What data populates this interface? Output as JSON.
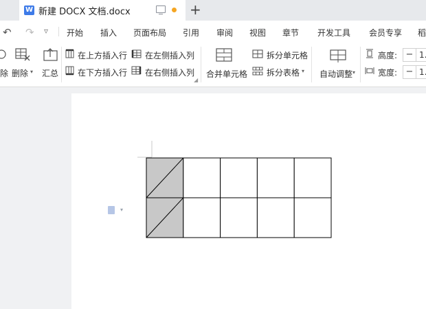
{
  "tab": {
    "doc_icon": "W",
    "title": "新建 DOCX 文档.docx",
    "monitor_icon": "monitor-icon",
    "unsaved_dot_color": "#f5a623",
    "new_tab": "+"
  },
  "quick": {
    "undo": "↶",
    "redo": "↷",
    "more": "▿"
  },
  "menu": [
    "开始",
    "插入",
    "页面布局",
    "引用",
    "审阅",
    "视图",
    "章节",
    "开发工具",
    "会员专享",
    "稻"
  ],
  "ribbon": {
    "delete_partial": "除",
    "delete": "删除",
    "summary": "汇总",
    "insert_above": "在上方插入行",
    "insert_below": "在下方插入行",
    "insert_left": "在左侧插入列",
    "insert_right": "在右侧插入列",
    "merge_cells": "合并单元格",
    "split_cells": "拆分单元格",
    "split_table": "拆分表格",
    "auto_fit": "自动调整",
    "height_label": "高度:",
    "width_label": "宽度:",
    "height_value": "1.",
    "width_value": "1.",
    "minus": "−"
  },
  "table": {
    "rows": 2,
    "cols": 5,
    "shaded_color": "#c8c8c8",
    "shaded_column": 0
  },
  "accent_color": "#3e7be8"
}
